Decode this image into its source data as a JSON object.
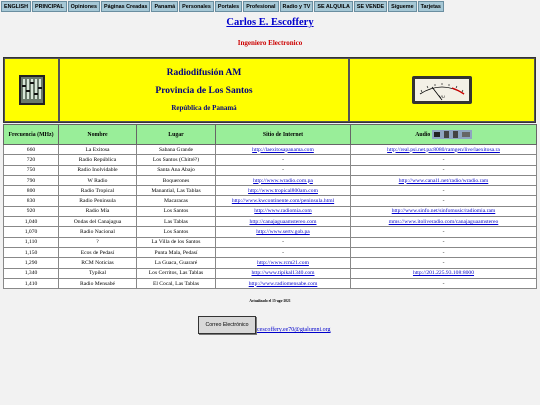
{
  "nav": [
    "ENGLISH",
    "PRINCIPAL",
    "Opiniones",
    "Páginas Creadas",
    "Panamá",
    "Personales",
    "Portales",
    "Profesional",
    "Radio y TV",
    "SE ALQUILA",
    "SE VENDE",
    "Sígueme",
    "Tarjetas"
  ],
  "site": {
    "title": "Carlos E. Escoffery",
    "subtitle": "Ingeniero Electronico"
  },
  "header": {
    "title": "Radiodifusión AM",
    "province": "Provincia de Los Santos",
    "country": "República de Panamá",
    "left_icon": "audio-equalizer-icon",
    "right_icon": "vu-meter-icon",
    "meter_label": "VU"
  },
  "columns": [
    "Frecuencia (MHz)",
    "Nombre",
    "Lugar",
    "Sitio de Internet",
    "Audio"
  ],
  "audio_icon": "speaker-icon",
  "rows": [
    [
      "660",
      "La Exitosa",
      "Sabana Grande",
      "http://laexitosapanama.com",
      "http://real.psi.net.pa:8080/ramgen/live/laexitosa.ra"
    ],
    [
      "720",
      "Radio República",
      "Los Santos (Chitré?)",
      "-",
      "-"
    ],
    [
      "750",
      "Radio Inolvidable",
      "Santa Ana Abajo",
      "-",
      "-"
    ],
    [
      "790",
      "W Radio",
      "Boquerones",
      "http://www.wradio.com.pa",
      "http://www.canal1.net/radio/wradio.ram"
    ],
    [
      "800",
      "Radio Tropical",
      "Manantial, Las Tablas",
      "http://www.tropical800am.com",
      "-"
    ],
    [
      "830",
      "Radio Peninsula",
      "Macaracas",
      "http://www.kwcontinente.com/peninsula.html",
      "-"
    ],
    [
      "920",
      "Radio Mía",
      "Los Santos",
      "http://www.radiomia.com",
      "http://www.sinfo.net/sinfomusic/radiomia.ram"
    ],
    [
      "1,040",
      "Ondas del Canajagua",
      "Las Tablas",
      "http://canajaguaamstereo.com",
      "mms://www.itoliveradio.com/canajaguaamstereo"
    ],
    [
      "1,070",
      "Radio Nacional",
      "Los Santos",
      "http://www.sertv.gob.pa",
      "-"
    ],
    [
      "1,110",
      "?",
      "La Villa de los Santos",
      "-",
      "-"
    ],
    [
      "1,150",
      "Ecos de Pedasí",
      "Punta Mala, Pedasí",
      "-",
      "-"
    ],
    [
      "1,290",
      "RCM Noticias",
      "La Guaca, Guararé",
      "http://www.rcm21.com",
      "-"
    ],
    [
      "1,340",
      "Typikal",
      "Los Cerritos, Las Tablas",
      "http://www.tipikal1340.com",
      "http://201.225.93.108:8000"
    ],
    [
      "1,410",
      "Radio Mensabé",
      "El Cocal, Las Tablas",
      "http://www.radiomensabe.com",
      "-"
    ]
  ],
  "footer": {
    "updated": "Actualizado el 15-ago-2021",
    "email_button": "Correo Electrónico",
    "email": "cescoffery.ee70@gtalumni.org"
  }
}
